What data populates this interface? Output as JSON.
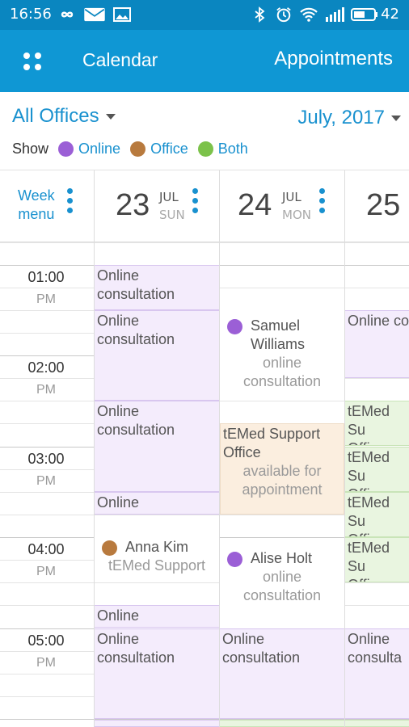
{
  "status_bar": {
    "time": "16:56",
    "battery": "42",
    "icons": [
      "infinity-icon",
      "mail-icon",
      "image-icon",
      "bluetooth-icon",
      "alarm-icon",
      "wifi-icon",
      "signal-icon",
      "battery-icon"
    ]
  },
  "app_bar": {
    "title": "Calendar",
    "right_title": "Appointments",
    "menu_icon": "grid-menu-icon"
  },
  "filter": {
    "office": "All Offices",
    "month": "July, 2017",
    "show_label": "Show",
    "legend": [
      {
        "label": "Online",
        "color": "#9b5fd6"
      },
      {
        "label": "Office",
        "color": "#b87a3e"
      },
      {
        "label": "Both",
        "color": "#7cc24a"
      }
    ]
  },
  "week_menu": {
    "line1": "Week",
    "line2": "menu"
  },
  "days": [
    {
      "num": "23",
      "month": "JUL",
      "dow": "SUN"
    },
    {
      "num": "24",
      "month": "JUL",
      "dow": "MON"
    },
    {
      "num": "25",
      "month": "",
      "dow": ""
    }
  ],
  "time_labels": [
    {
      "time": "01:00",
      "ampm": "PM"
    },
    {
      "time": "02:00",
      "ampm": "PM"
    },
    {
      "time": "03:00",
      "ampm": "PM"
    },
    {
      "time": "04:00",
      "ampm": "PM"
    },
    {
      "time": "05:00",
      "ampm": "PM"
    }
  ],
  "events": {
    "sun": [
      {
        "title": "Online consultation"
      },
      {
        "title": "Online consultation"
      },
      {
        "title": "Online consultation"
      },
      {
        "title": "Online"
      },
      {
        "name": "Anna Kim",
        "sub": "tEMed Support"
      },
      {
        "title": "Online"
      },
      {
        "title": "Online consultation"
      }
    ],
    "mon": [
      {
        "name": "Samuel Williams",
        "sub": "online consultation"
      },
      {
        "title": "tEMed Support Office",
        "sub": "available for appointment"
      },
      {
        "name": "Alise Holt",
        "sub": "online consultation"
      },
      {
        "title": "Online consultation"
      }
    ],
    "tue": [
      {
        "title": "Online consulta"
      },
      {
        "title": "tEMed Su Office"
      },
      {
        "title": "tEMed Su Office"
      },
      {
        "title": "tEMed Su Office"
      },
      {
        "title": "tEMed Su Office"
      },
      {
        "title": "Online consulta"
      }
    ]
  }
}
